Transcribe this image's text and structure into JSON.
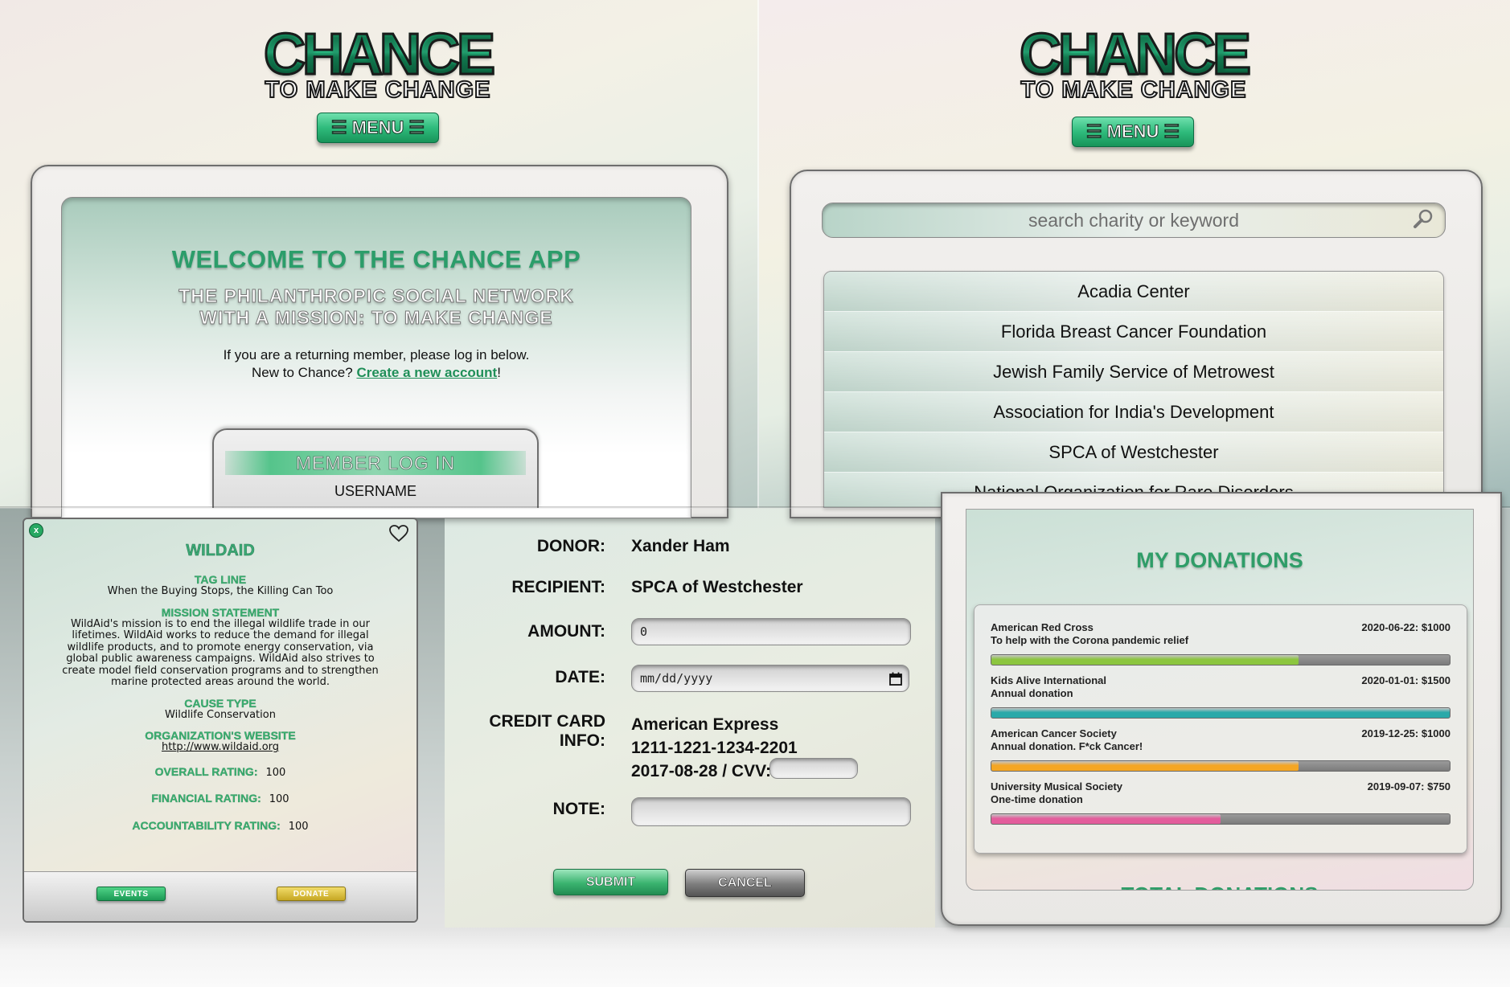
{
  "logo": {
    "big": "CHANCE",
    "small": "TO MAKE CHANGE"
  },
  "menu": {
    "label": "MENU",
    "icon": "hamburger-icon"
  },
  "welcome": {
    "title": "WELCOME TO THE CHANCE APP",
    "subtitle_line1": "THE PHILANTHROPIC SOCIAL NETWORK",
    "subtitle_line2": "WITH A MISSION: TO MAKE CHANGE",
    "text_line1": "If you are a returning member, please log in below.",
    "text_prefix": "New to Chance? ",
    "create_link": "Create a new account",
    "text_suffix": "!",
    "login_title": "MEMBER LOG IN",
    "username_label": "USERNAME"
  },
  "search": {
    "placeholder": "search charity or keyword",
    "results": [
      "Acadia Center",
      "Florida Breast Cancer Foundation",
      "Jewish Family Service of Metrowest",
      "Association for India's Development",
      "SPCA of Westchester",
      "National Organization for Rare Disorders"
    ]
  },
  "charity": {
    "close_label": "x",
    "name": "WILDAID",
    "tagline_label": "TAG LINE",
    "tagline": "When the Buying Stops, the Killing Can Too",
    "mission_label": "MISSION STATEMENT",
    "mission_lines": [
      "WildAid's mission is to end the illegal wildlife trade in our",
      "lifetimes. WildAid works to reduce the demand for illegal",
      "wildlife products, and to promote energy conservation, via",
      "global public awareness campaigns. WildAid also strives to",
      "create model field conservation programs and to strengthen",
      "marine protected areas around the world."
    ],
    "cause_label": "CAUSE TYPE",
    "cause": "Wildlife Conservation",
    "website_label": "ORGANIZATION'S WEBSITE",
    "website": "http://www.wildaid.org",
    "overall_label": "OVERALL RATING:",
    "overall": "100",
    "financial_label": "FINANCIAL RATING:",
    "financial": "100",
    "accountability_label": "ACCOUNTABILITY RATING:",
    "accountability": "100",
    "events_btn": "EVENTS",
    "donate_btn": "DONATE"
  },
  "donation_form": {
    "donor_label": "DONOR:",
    "donor": "Xander Ham",
    "recipient_label": "RECIPIENT:",
    "recipient": "SPCA of Westchester",
    "amount_label": "AMOUNT:",
    "amount": "0",
    "date_label": "DATE:",
    "date_placeholder": "mm/dd/yyyy",
    "card_label": "CREDIT CARD INFO:",
    "card_type": "American Express",
    "card_number": "1211-1221-1234-2201",
    "card_expiry": "2017-08-28 / CVV:",
    "note_label": "NOTE:",
    "submit": "SUBMIT",
    "cancel": "CANCEL"
  },
  "my_donations": {
    "title": "MY DONATIONS",
    "total_title": "TOTAL DONATIONS",
    "items": [
      {
        "org": "American Red Cross",
        "note": "To help with the Corona pandemic relief",
        "date_amount": "2020-06-22: $1000",
        "progress": 0.67,
        "color": "#8cc63f"
      },
      {
        "org": "Kids Alive International",
        "note": "Annual donation",
        "date_amount": "2020-01-01: $1500",
        "progress": 1.0,
        "color": "#2aa9a9"
      },
      {
        "org": "American Cancer Society",
        "note": "Annual donation. F*ck Cancer!",
        "date_amount": "2019-12-25: $1000",
        "progress": 0.67,
        "color": "#f5a623"
      },
      {
        "org": "University Musical Society",
        "note": "One-time donation",
        "date_amount": "2019-09-07: $750",
        "progress": 0.5,
        "color": "#e35d9c"
      }
    ]
  }
}
